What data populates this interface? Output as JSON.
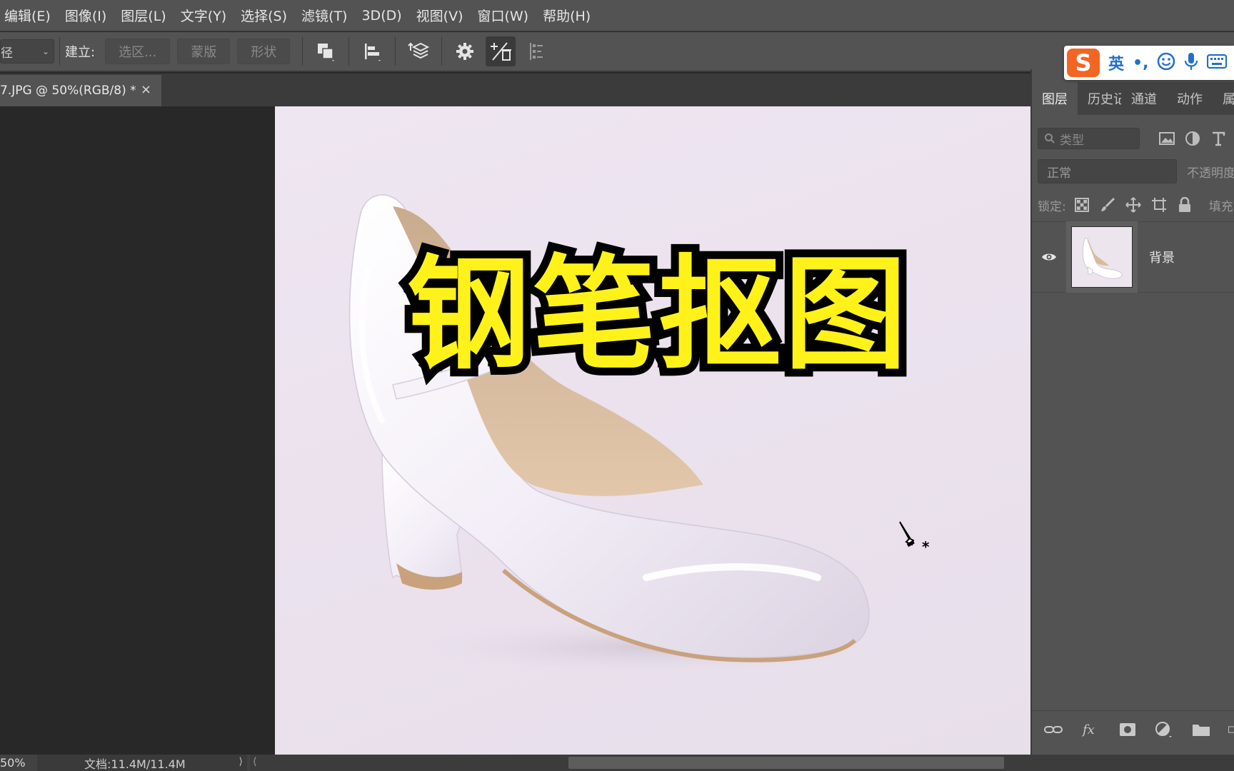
{
  "menubar": {
    "items": [
      "编辑(E)",
      "图像(I)",
      "图层(L)",
      "文字(Y)",
      "选择(S)",
      "滤镜(T)",
      "3D(D)",
      "视图(V)",
      "窗口(W)",
      "帮助(H)"
    ]
  },
  "options": {
    "mode_value": "径",
    "make_label": "建立:",
    "selection_btn": "选区...",
    "mask_btn": "蒙版",
    "shape_btn": "形状"
  },
  "document": {
    "tab_title": "7.JPG @ 50%(RGB/8) *",
    "close_glyph": "×"
  },
  "overlay": {
    "title": "钢笔抠图"
  },
  "layers_panel": {
    "tabs": [
      "图层",
      "历史记录",
      "通道",
      "动作",
      "属"
    ],
    "active_tab": 0,
    "filter_label": "类型",
    "blend_mode": "正常",
    "opacity_label": "不透明度",
    "lock_label": "锁定:",
    "fill_label": "填充",
    "layer_name": "背景"
  },
  "ime": {
    "logo": "S",
    "lang": "英",
    "punc": "•,"
  },
  "status": {
    "zoom": "50%",
    "doc_info": "文档:11.4M/11.4M"
  },
  "colors": {
    "overlay_fill": "#fff21a",
    "overlay_stroke": "#000000",
    "ime_brand": "#f26522"
  }
}
